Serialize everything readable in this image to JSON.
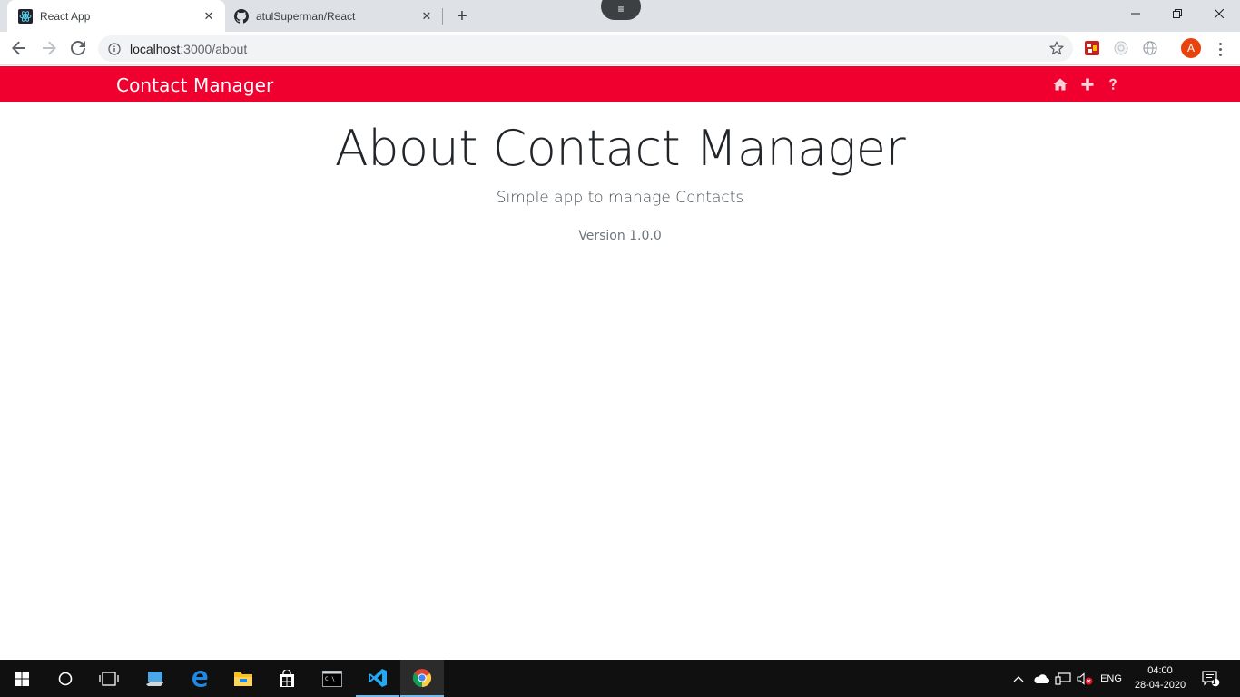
{
  "browser": {
    "tabs": [
      {
        "title": "React App",
        "active": true,
        "favicon": "react-icon"
      },
      {
        "title": "atulSuperman/React",
        "active": false,
        "favicon": "github-icon"
      }
    ],
    "url_host": "localhost",
    "url_path": ":3000/about",
    "profile_initial": "A"
  },
  "app": {
    "brand": "Contact Manager",
    "nav_icons": [
      "home-icon",
      "plus-icon",
      "question-icon"
    ]
  },
  "page": {
    "heading": "About Contact Manager",
    "lead": "Simple app to manage Contacts",
    "version": "Version 1.0.0"
  },
  "taskbar": {
    "apps": [
      "start-icon",
      "cortana-icon",
      "task-view-icon",
      "file-share-icon",
      "edge-icon",
      "file-explorer-icon",
      "store-icon",
      "terminal-icon",
      "vscode-icon",
      "chrome-icon"
    ],
    "language": "ENG",
    "time": "04:00",
    "date": "28-04-2020",
    "notification_count": "1"
  },
  "colors": {
    "navbar": "#f0002e",
    "tabstrip": "#dee1e6"
  }
}
